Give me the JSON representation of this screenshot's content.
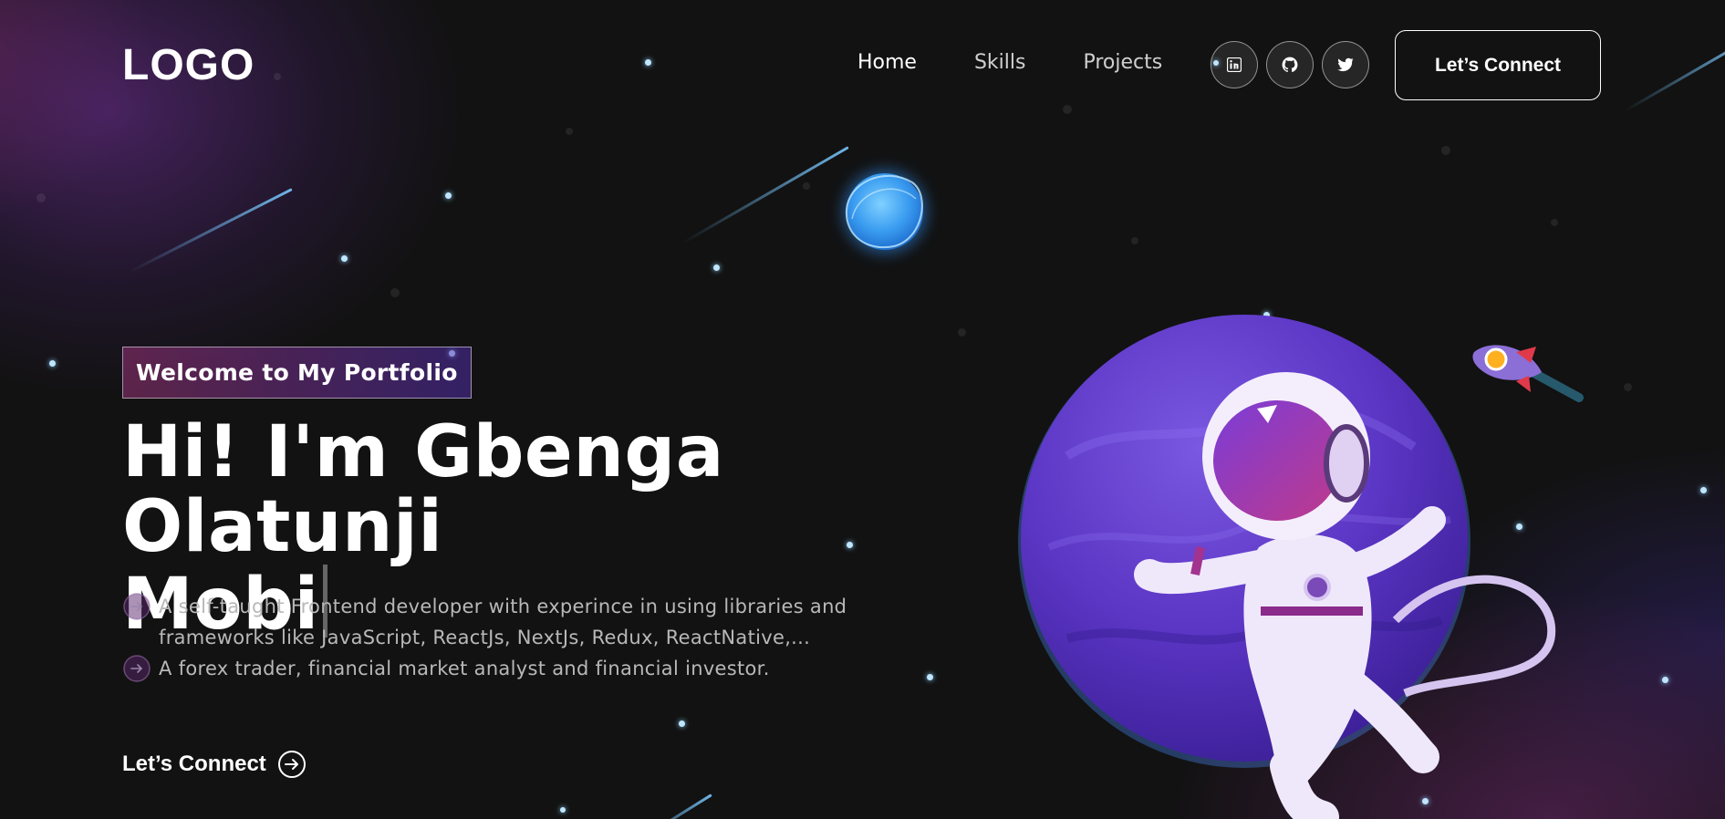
{
  "navbar": {
    "logo": "LOGO",
    "links": [
      {
        "label": "Home",
        "active": true
      },
      {
        "label": "Skills",
        "active": false
      },
      {
        "label": "Projects",
        "active": false
      }
    ],
    "social_icons": [
      "linkedin-icon",
      "github-icon",
      "twitter-icon"
    ],
    "connect_label": "Let’s Connect"
  },
  "banner": {
    "tagline": "Welcome to My Portfolio",
    "headline_line1": "Hi! I'm Gbenga Olatunji",
    "headline_line2": "Mobi",
    "bullets": [
      "A self-taught Frontend developer with experince in using libraries and frameworks like JavaScript, ReactJs, NextJs, Redux, ReactNative,...",
      "A forex trader, financial market analyst and financial investor."
    ],
    "connect_label": "Let’s Connect"
  },
  "colors": {
    "background": "#121212",
    "tagline_gradient_start": "#AA367C",
    "tagline_gradient_end": "#4A2FBD",
    "planet": "#6a3fd0",
    "glow_planet": "#4fb3ff"
  }
}
